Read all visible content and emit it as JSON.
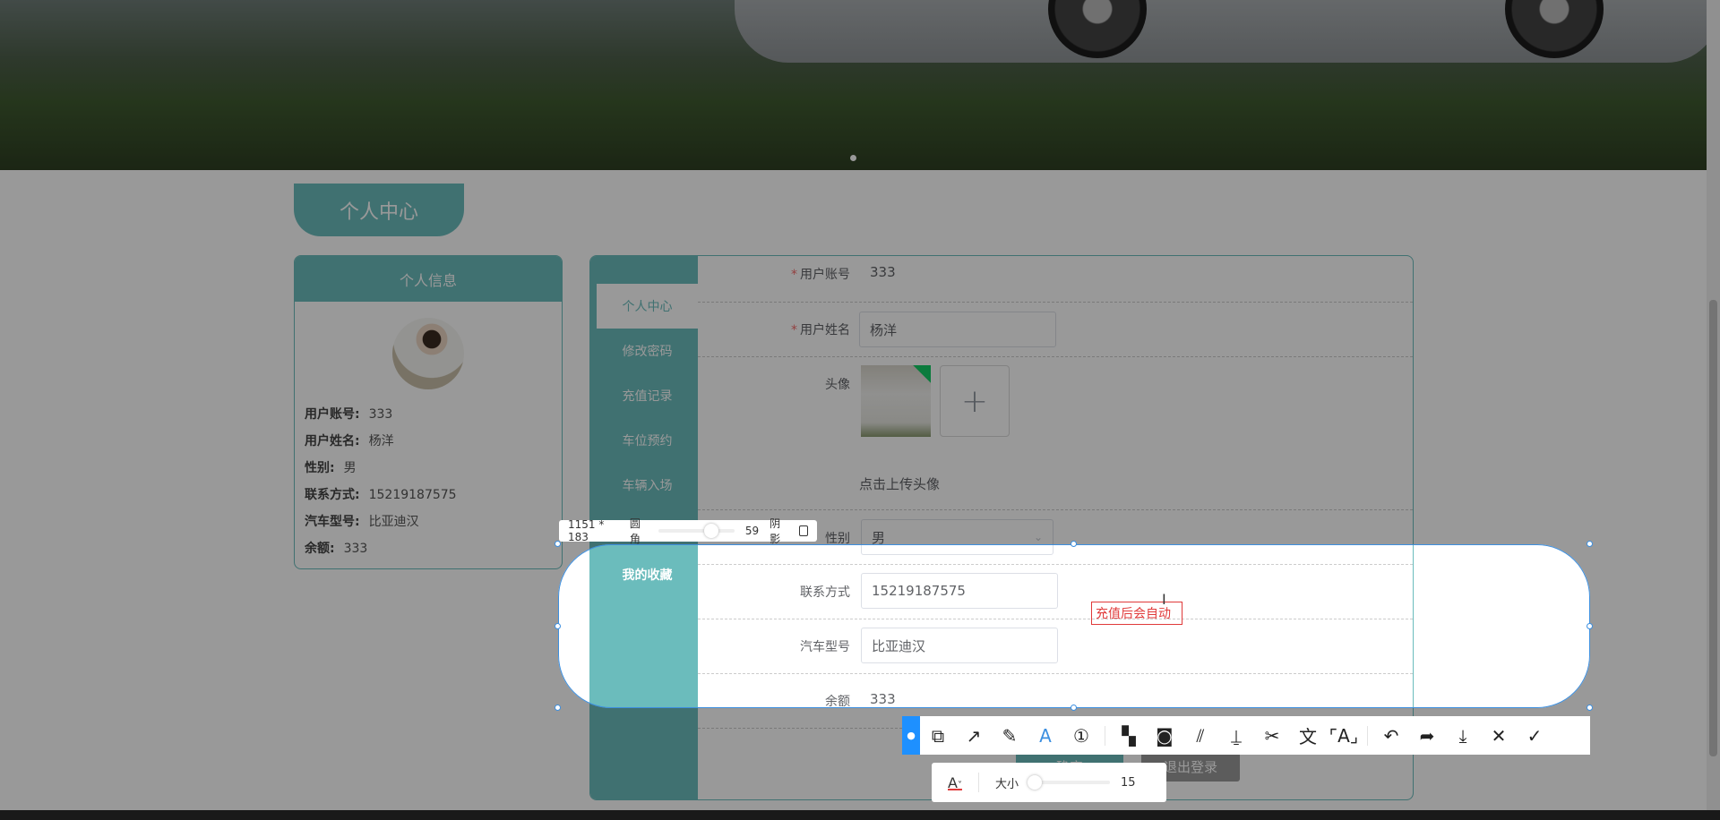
{
  "page_title_tab": "个人中心",
  "info_card": {
    "title": "个人信息",
    "rows": [
      {
        "label": "用户账号:",
        "value": "333"
      },
      {
        "label": "用户姓名:",
        "value": "杨洋"
      },
      {
        "label": "性别:",
        "value": "男"
      },
      {
        "label": "联系方式:",
        "value": "15219187575"
      },
      {
        "label": "汽车型号:",
        "value": "比亚迪汉"
      },
      {
        "label": "余额:",
        "value": "333"
      }
    ]
  },
  "sidenav": [
    "个人中心",
    "修改密码",
    "充值记录",
    "车位预约",
    "车辆入场",
    "我的收藏"
  ],
  "form": {
    "account_label": "用户账号",
    "account_value": "333",
    "name_label": "用户姓名",
    "name_value": "杨洋",
    "avatar_label": "头像",
    "upload_hint": "点击上传头像",
    "gender_label": "性别",
    "gender_value": "男",
    "phone_label": "联系方式",
    "phone_value": "15219187575",
    "car_label": "汽车型号",
    "car_value": "比亚迪汉",
    "balance_label": "余额",
    "balance_value": "333",
    "confirm_button": "确定",
    "logout_button": "退出登录"
  },
  "screenshot_tool": {
    "size_readout": "1151 * 183",
    "radius_label": "圆角",
    "radius_value": "59",
    "radius_fraction": 0.59,
    "shadow_label": "阴影",
    "text_annotation": "充值后会自动",
    "font_size_label": "大小",
    "font_size_value": "15",
    "text_color": "#e03a3a",
    "accent": "#3c8fe0"
  },
  "colors": {
    "teal": "#6bbcbc"
  }
}
